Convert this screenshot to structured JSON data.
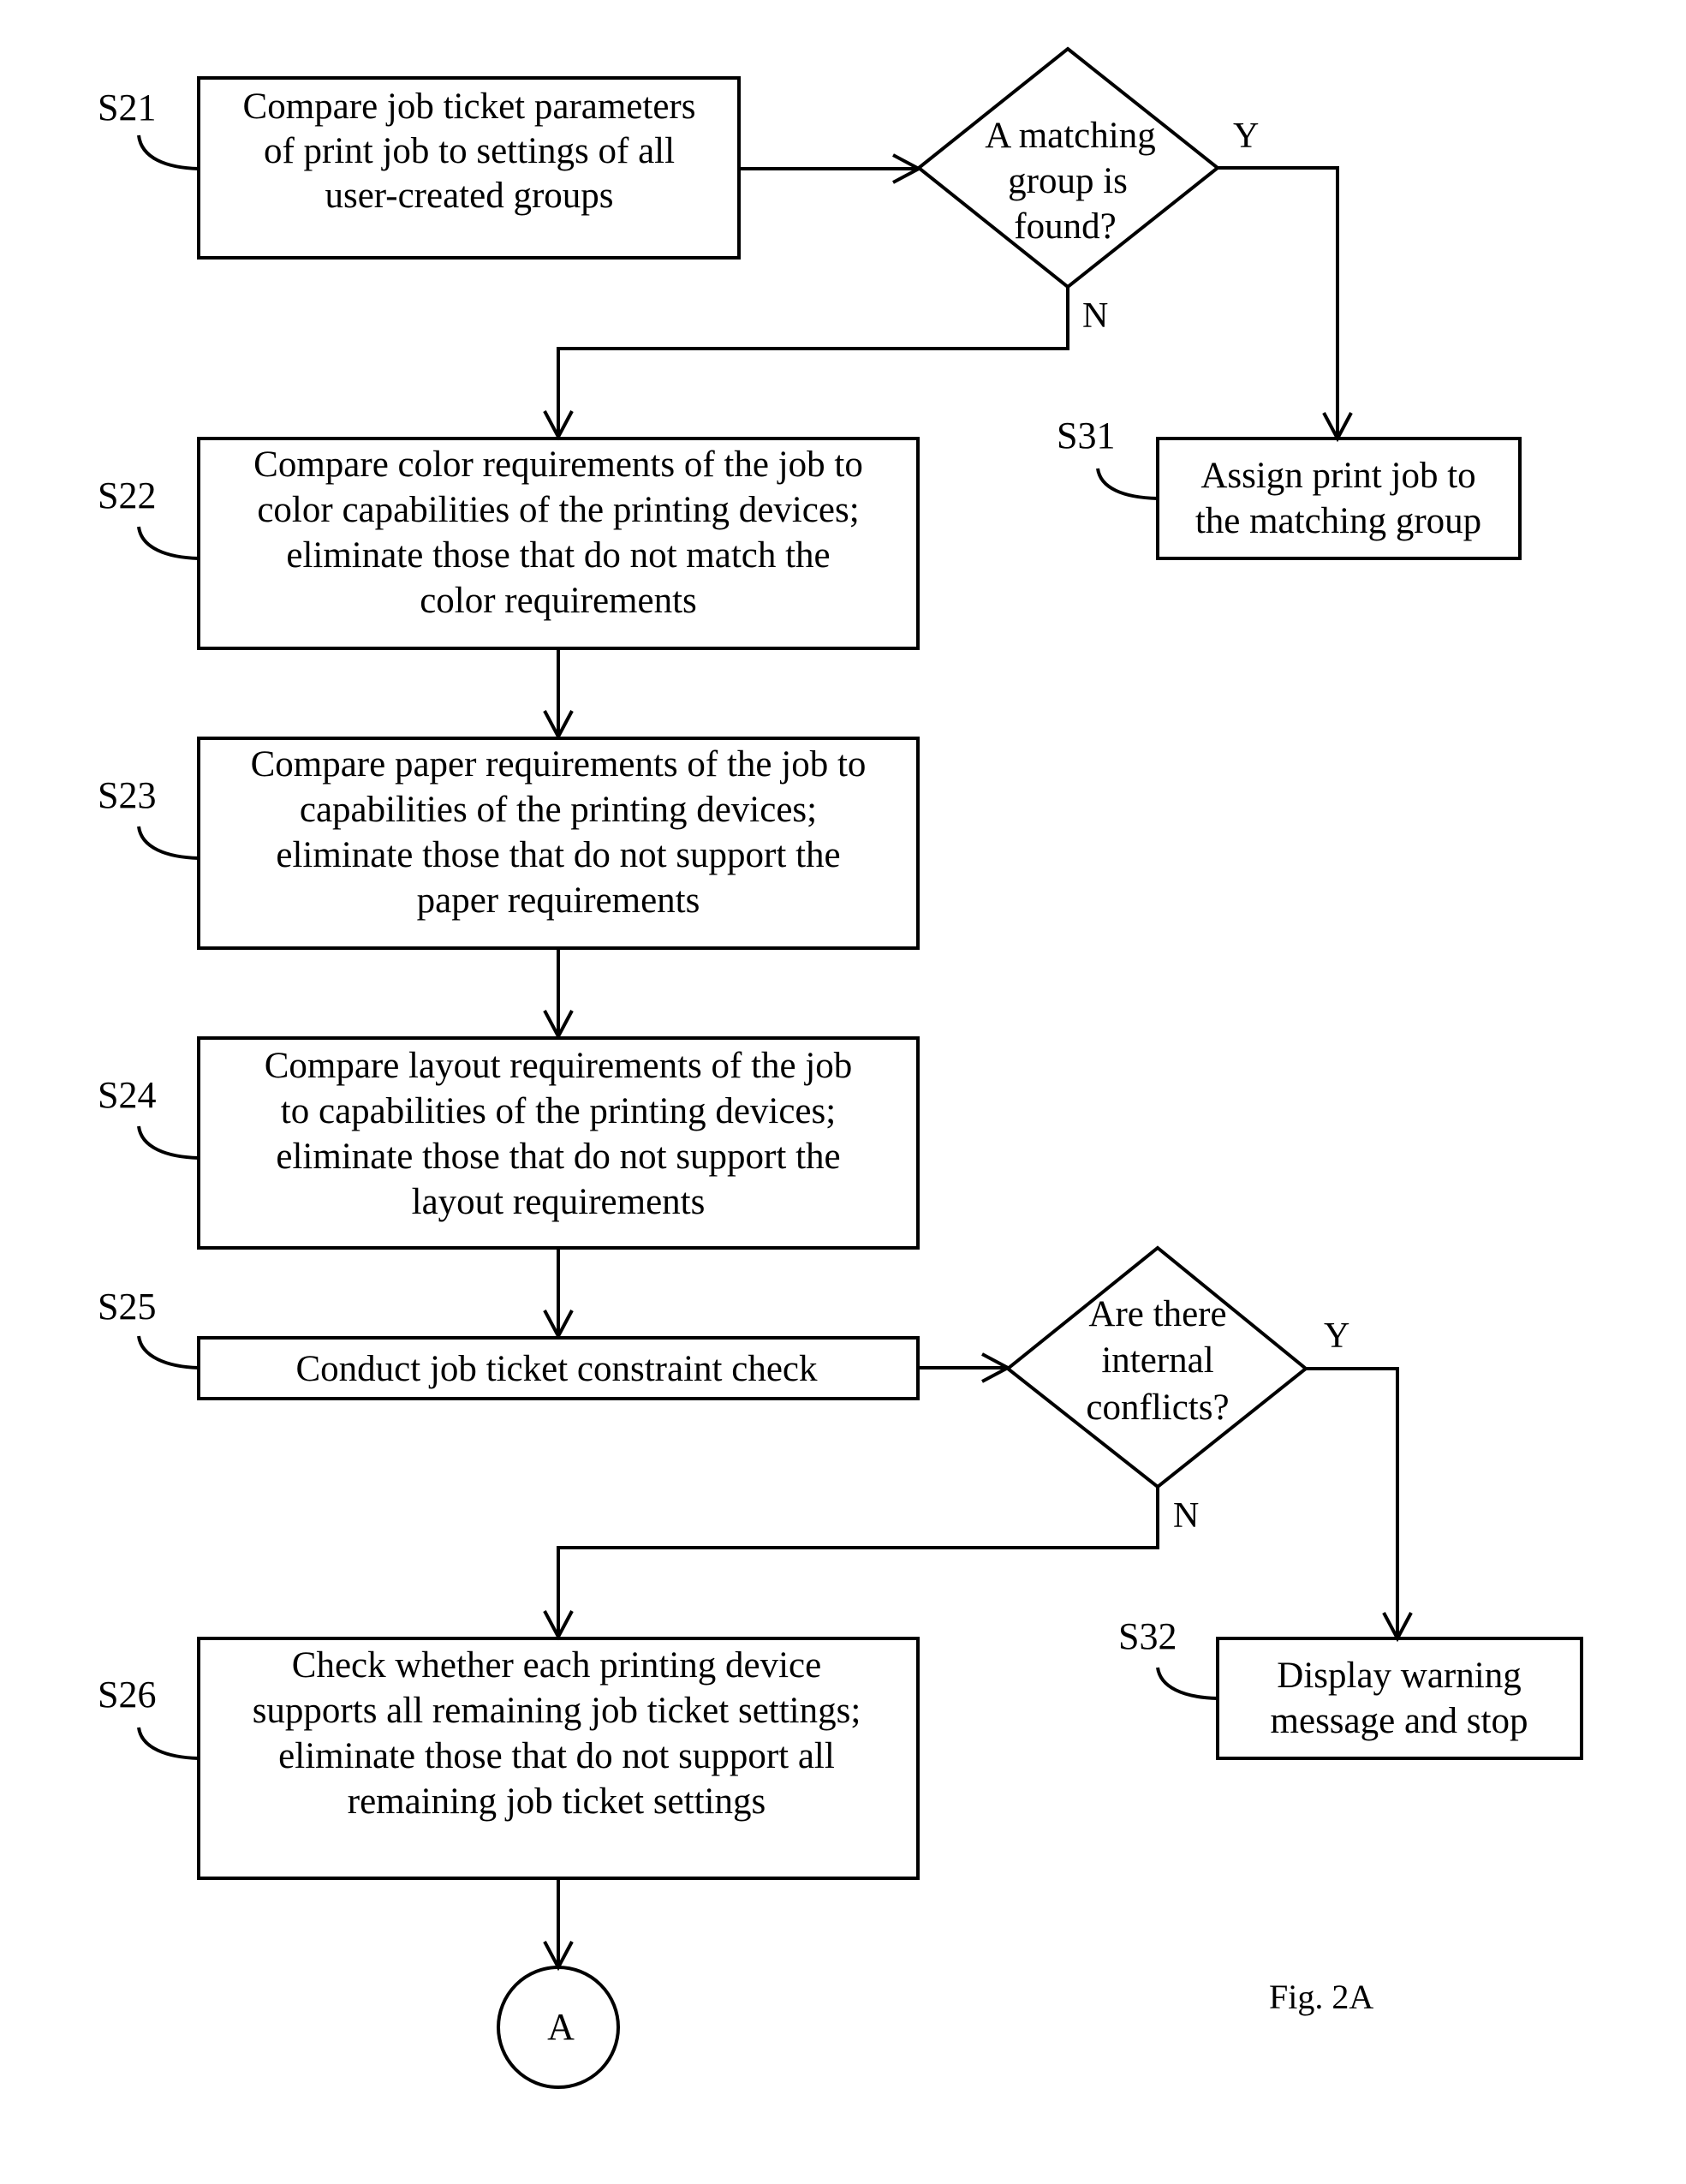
{
  "figure": {
    "caption": "Fig. 2A"
  },
  "steps": {
    "s21": {
      "label": "S21",
      "lines": [
        "Compare job ticket parameters",
        "of print job to settings of all",
        "user-created groups"
      ]
    },
    "s22": {
      "label": "S22",
      "lines": [
        "Compare color requirements of the job to",
        "color capabilities of the printing devices;",
        "eliminate those that do not match the",
        "color requirements"
      ]
    },
    "s23": {
      "label": "S23",
      "lines": [
        "Compare paper requirements of the job to",
        "capabilities of the printing devices;",
        "eliminate those that do not support the",
        "paper requirements"
      ]
    },
    "s24": {
      "label": "S24",
      "lines": [
        "Compare layout requirements of the job",
        "to capabilities of the printing devices;",
        "eliminate those that do not support the",
        "layout requirements"
      ]
    },
    "s25": {
      "label": "S25",
      "lines": [
        "Conduct job ticket constraint check"
      ]
    },
    "s26": {
      "label": "S26",
      "lines": [
        "Check whether each printing device",
        "supports all remaining job ticket settings;",
        "eliminate those that do not support all",
        "remaining job ticket settings"
      ]
    },
    "s31": {
      "label": "S31",
      "lines": [
        "Assign print job to",
        "the matching group"
      ]
    },
    "s32": {
      "label": "S32",
      "lines": [
        "Display warning",
        "message and stop"
      ]
    }
  },
  "decisions": {
    "d1": {
      "lines": [
        "A matching",
        "group is",
        "found?"
      ],
      "yes_label": "Y",
      "no_label": "N"
    },
    "d2": {
      "lines": [
        "Are there",
        "internal",
        "conflicts?"
      ],
      "yes_label": "Y",
      "no_label": "N"
    }
  },
  "connector": {
    "label": "A"
  }
}
